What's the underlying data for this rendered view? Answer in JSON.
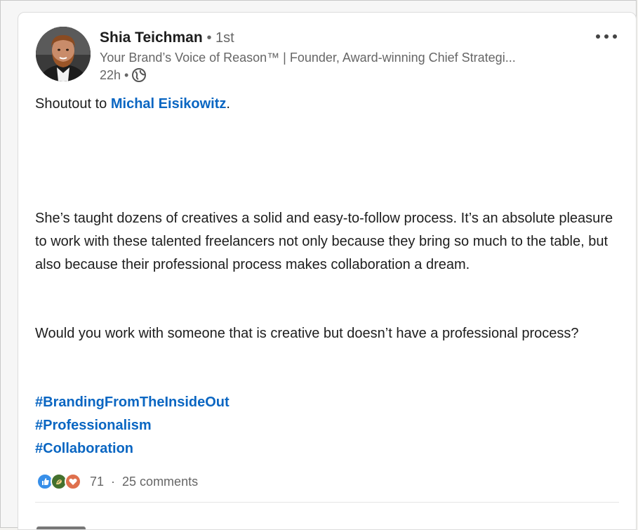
{
  "post": {
    "author": {
      "name": "Shia Teichman",
      "connection": "• 1st",
      "headline": "Your Brand’s Voice of Reason™ | Founder, Award-winning Chief Strategi...",
      "time": "22h •",
      "visibility_icon": "globe-icon"
    },
    "menu_icon": "more-horizontal-icon",
    "intro": {
      "prefix": "Shoutout to ",
      "mention": "Michal Eisikowitz",
      "suffix": "."
    },
    "paragraph1": "She’s taught dozens of creatives a solid and easy-to-follow process. It’s an absolute pleasure to work with these talented freelancers not only because they bring so much to the table, but also because their professional process makes collaboration a dream.",
    "paragraph2": "Would you work with someone that is creative but doesn’t have a professional process?",
    "hashtags": [
      "#BrandingFromTheInsideOut",
      "#Professionalism",
      "#Collaboration"
    ],
    "social": {
      "reaction_icons": [
        "like-icon",
        "celebrate-icon",
        "love-icon"
      ],
      "reaction_count": "71",
      "separator": "·",
      "comments": "25 comments"
    },
    "colors": {
      "link": "#0a66c2",
      "like": "#378fe9",
      "celebrate": "#44712e",
      "love": "#df704d"
    }
  }
}
